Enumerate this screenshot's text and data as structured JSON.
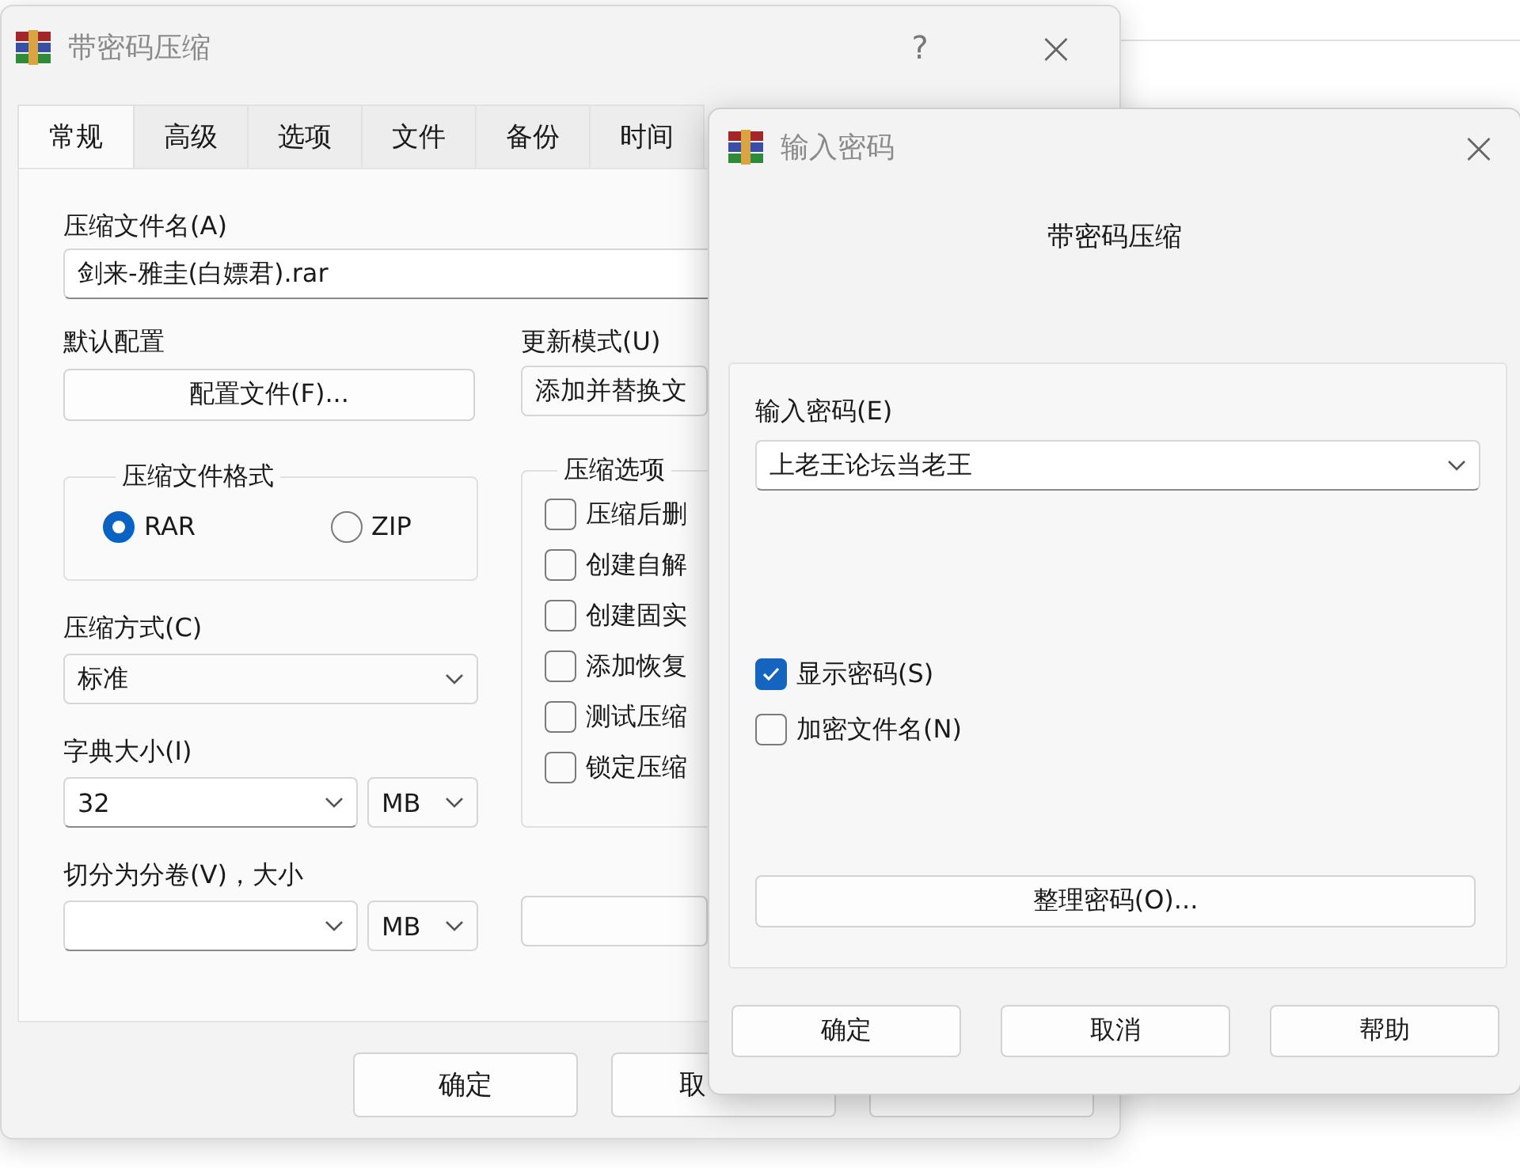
{
  "main_window": {
    "title": "带密码压缩",
    "help": "?",
    "close": "×",
    "tabs": [
      {
        "label": "常规",
        "selected": true
      },
      {
        "label": "高级",
        "selected": false
      },
      {
        "label": "选项",
        "selected": false
      },
      {
        "label": "文件",
        "selected": false
      },
      {
        "label": "备份",
        "selected": false
      },
      {
        "label": "时间",
        "selected": false
      }
    ],
    "archive_name": {
      "label": "压缩文件名(A)",
      "value": "剑来-雅圭(白嫖君).rar"
    },
    "profile": {
      "label": "默认配置",
      "button": "配置文件(F)..."
    },
    "update_mode": {
      "label": "更新模式(U)",
      "value": "添加并替换文"
    },
    "archive_format": {
      "title": "压缩文件格式",
      "options": [
        {
          "label": "RAR",
          "selected": true
        },
        {
          "label": "ZIP",
          "selected": false
        }
      ]
    },
    "compression_method": {
      "label": "压缩方式(C)",
      "value": "标准"
    },
    "dictionary_size": {
      "label": "字典大小(I)",
      "value": "32",
      "unit": "MB"
    },
    "split_volumes": {
      "label": "切分为分卷(V)，大小",
      "unit": "MB"
    },
    "archive_options": {
      "title": "压缩选项",
      "items": [
        {
          "label": "压缩后删",
          "checked": false
        },
        {
          "label": "创建自解",
          "checked": false
        },
        {
          "label": "创建固实",
          "checked": false
        },
        {
          "label": "添加恢复",
          "checked": false
        },
        {
          "label": "测试压缩",
          "checked": false
        },
        {
          "label": "锁定压缩",
          "checked": false
        }
      ]
    },
    "buttons": [
      "确定",
      "取"
    ]
  },
  "password_dialog": {
    "title": "输入密码",
    "close": "×",
    "heading": "带密码压缩",
    "password": {
      "label": "输入密码(E)",
      "value": "上老王论坛当老王"
    },
    "options": [
      {
        "label": "显示密码(S)",
        "checked": true
      },
      {
        "label": "加密文件名(N)",
        "checked": false
      }
    ],
    "organize_button": "整理密码(O)...",
    "buttons": [
      "确定",
      "取消",
      "帮助"
    ]
  }
}
